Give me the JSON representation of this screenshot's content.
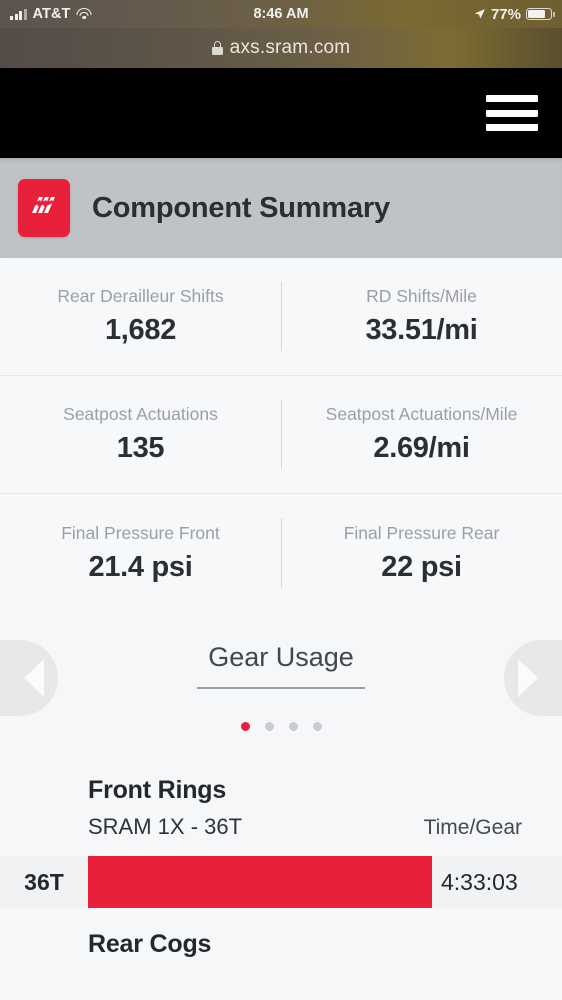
{
  "status_bar": {
    "carrier": "AT&T",
    "time": "8:46 AM",
    "battery_percent": "77%",
    "signal_icon": "cellular-signal-icon",
    "wifi_icon": "wifi-icon",
    "location_icon": "location-arrow-icon",
    "battery_icon": "battery-icon"
  },
  "browser": {
    "url": "axs.sram.com",
    "lock_icon": "lock-icon"
  },
  "nav": {
    "menu_icon": "hamburger-menu-icon"
  },
  "summary": {
    "title": "Component Summary",
    "logo_icon": "sram-axs-logo-icon",
    "logo_color": "#e8203a",
    "header_bg": "#bfc3c7"
  },
  "stats": [
    [
      {
        "label": "Rear Derailleur Shifts",
        "value": "1,682"
      },
      {
        "label": "RD Shifts/Mile",
        "value": "33.51/mi"
      }
    ],
    [
      {
        "label": "Seatpost Actuations",
        "value": "135"
      },
      {
        "label": "Seatpost Actuations/Mile",
        "value": "2.69/mi"
      }
    ],
    [
      {
        "label": "Final Pressure Front",
        "value": "21.4 psi"
      },
      {
        "label": "Final Pressure Rear",
        "value": "22 psi"
      }
    ]
  ],
  "carousel": {
    "title": "Gear Usage",
    "prev_icon": "chevron-left-icon",
    "next_icon": "chevron-right-icon",
    "dot_count": 4,
    "active_dot": 0,
    "active_color": "#e8203a",
    "inactive_color": "#c9ccd0"
  },
  "gear_usage": {
    "front_rings_heading": "Front Rings",
    "front_rings_spec": "SRAM 1X - 36T",
    "time_per_gear_header": "Time/Gear",
    "rear_cogs_heading": "Rear Cogs"
  },
  "chart_data": {
    "type": "bar",
    "title": "Front Rings",
    "subtitle": "SRAM 1X - 36T",
    "xlabel": "Time/Gear",
    "ylabel": "",
    "orientation": "horizontal",
    "bar_color": "#e8203a",
    "categories": [
      "36T"
    ],
    "value_labels": [
      "4:33:03"
    ],
    "values": [
      100
    ],
    "values_unit": "percent-of-track",
    "series": [
      {
        "name": "Time/Gear",
        "values": [
          100
        ],
        "labels": [
          "4:33:03"
        ]
      }
    ]
  }
}
